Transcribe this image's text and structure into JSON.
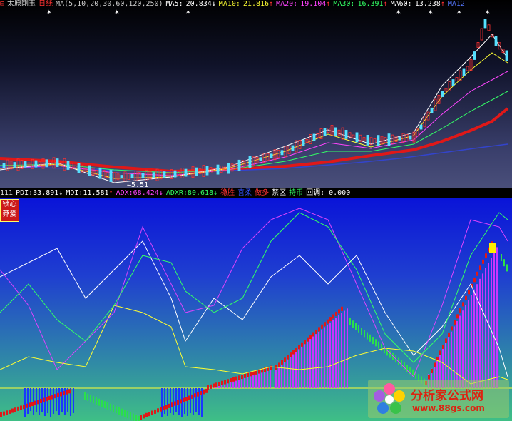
{
  "price_panel": {
    "title_marker": "⊟",
    "stock_name": "太原刚玉",
    "period": "日线",
    "ma_params": "MA(5,10,20,30,60,120,250)",
    "ma_values": [
      {
        "label": "MA5:",
        "value": "20.834",
        "arrow": "↓",
        "color": "#ffffff"
      },
      {
        "label": "MA10:",
        "value": "21.816",
        "arrow": "↑",
        "color": "#ffff33"
      },
      {
        "label": "MA20:",
        "value": "19.104",
        "arrow": "↑",
        "color": "#ff44ff"
      },
      {
        "label": "MA30:",
        "value": "16.391",
        "arrow": "↑",
        "color": "#33ff66"
      },
      {
        "label": "MA60:",
        "value": "13.238",
        "arrow": "↑",
        "color": "#ff3333"
      },
      {
        "label": "MA12",
        "value": "",
        "arrow": "",
        "color": "#5577ff"
      }
    ],
    "low_price_label": "5.51"
  },
  "indicator_panel": {
    "period_code": "111",
    "items": [
      {
        "label": "PDI:",
        "value": "33.891",
        "arrow": "↓",
        "color": "#ffffff"
      },
      {
        "label": "MDI:",
        "value": "11.581",
        "arrow": "↑",
        "color": "#ffffff"
      },
      {
        "label": "ADX:",
        "value": "68.424",
        "arrow": "↓",
        "color": "#ff44ff"
      },
      {
        "label": "ADXR:",
        "value": "80.618",
        "arrow": "↓",
        "color": "#33ff66"
      }
    ],
    "tags": [
      {
        "text": "稳胜",
        "color": "#ff3333"
      },
      {
        "text": "喜柔",
        "color": "#3355ff"
      },
      {
        "text": "做多",
        "color": "#ff3333"
      },
      {
        "text": "禁区",
        "color": "#ffffff"
      },
      {
        "text": "持币",
        "color": "#33ff66"
      },
      {
        "text": "回调: 0.000",
        "color": "#ffffff"
      }
    ],
    "side_tag_line1": "锁心",
    "side_tag_line2": "莽爱"
  },
  "watermark": {
    "title": "分析家公式网",
    "url": "www.88gs.com"
  }
}
